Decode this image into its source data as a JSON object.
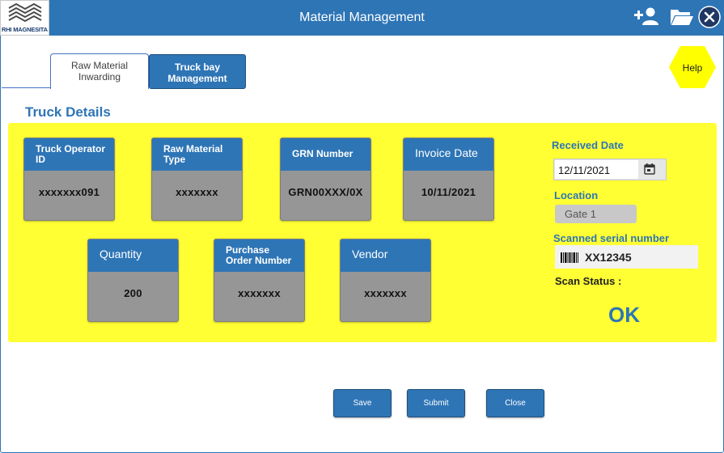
{
  "header": {
    "title": "Material Management",
    "logo_text": "RHI MAGNESITA",
    "icons": [
      "add-user-icon",
      "folder-open-icon",
      "close-icon"
    ],
    "accent_color": "#2e75b6"
  },
  "tabs": [
    {
      "line1": "Raw Material",
      "line2": "Inwarding",
      "active": true
    },
    {
      "line1": "Truck bay",
      "line2": "Management",
      "active": false
    }
  ],
  "help": {
    "label": "Help",
    "color": "#ffff00"
  },
  "section_title": "Truck Details",
  "cards": [
    {
      "line1": "Truck Operator",
      "line2": "ID",
      "value": "xxxxxxx091"
    },
    {
      "line1": "Raw Material",
      "line2": "Type",
      "value": "xxxxxxx"
    },
    {
      "line1": "GRN Number",
      "line2": "",
      "value": "GRN00XXX/0X"
    },
    {
      "line1": "Invoice Date",
      "line2": "",
      "value": "10/11/2021"
    },
    {
      "line1": "Quantity",
      "line2": "",
      "value": "200"
    },
    {
      "line1": "Purchase",
      "line2": "Order Number",
      "value": "xxxxxxx"
    },
    {
      "line1": "Vendor",
      "line2": "",
      "value": "xxxxxxx"
    }
  ],
  "received_date": {
    "label": "Received Date",
    "value": "12/11/2021",
    "icon": "calendar-icon"
  },
  "location": {
    "label": "Location",
    "placeholder": "Gate 1"
  },
  "scanned_serial": {
    "label": "Scanned serial number",
    "value": "XX12345",
    "icon": "barcode-icon"
  },
  "scan_status": {
    "label": "Scan Status :",
    "value": "OK"
  },
  "buttons": {
    "save": "Save",
    "submit": "Submit",
    "close": "Close"
  },
  "panel_color": "#ffff33"
}
